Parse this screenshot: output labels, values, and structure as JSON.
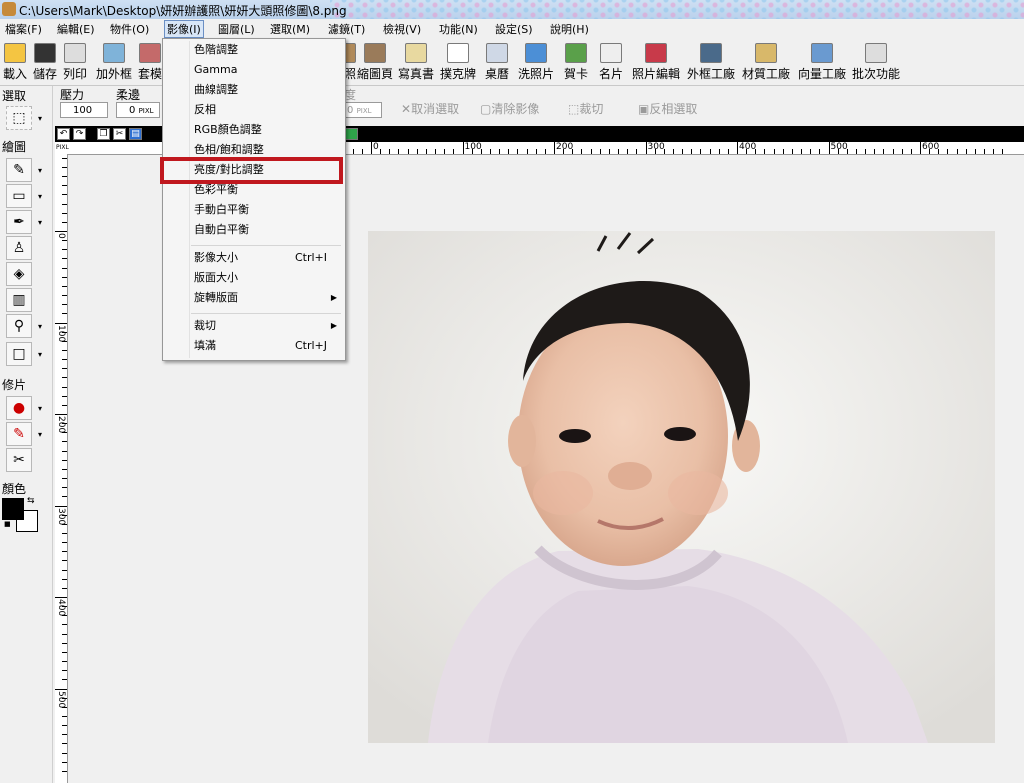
{
  "window": {
    "title": "C:\\Users\\Mark\\Desktop\\妍妍辦護照\\妍妍大頭照修圖\\8.png"
  },
  "menubar": {
    "items": [
      "檔案(F)",
      "編輯(E)",
      "物件(O)",
      "影像(I)",
      "圖層(L)",
      "選取(M)",
      "濾鏡(T)",
      "檢視(V)",
      "功能(N)",
      "設定(S)",
      "說明(H)"
    ],
    "active": "影像(I)"
  },
  "toolbar": {
    "left_items": [
      "載入",
      "儲存",
      "列印",
      "加外框",
      "套模"
    ],
    "right_items": [
      "照",
      "縮圖頁",
      "寫真書",
      "撲克牌",
      "桌曆",
      "洗照片",
      "賀卡",
      "名片",
      "照片編輯",
      "外框工廠",
      "材質工廠",
      "向量工廠",
      "批次功能"
    ]
  },
  "options": {
    "hardness_label": "壓力",
    "hardness_value": "100",
    "feather_label": "柔邊",
    "feather_value": "0",
    "unit": "PIXL",
    "degree_label": "度",
    "degree_value": "0",
    "cancel_selection": "取消選取",
    "clear_image": "清除影像",
    "crop": "裁切",
    "invert_selection": "反相選取"
  },
  "toolbox": {
    "select_label": "選取",
    "draw_label": "繪圖",
    "retouch_label": "修片",
    "color_label": "顏色",
    "fg_color": "#000000",
    "bg_color": "#ffffff"
  },
  "rulers": {
    "unit": "PIXL",
    "h_labels": [
      "0",
      "100",
      "200",
      "300",
      "400",
      "500",
      "600"
    ],
    "v_labels": [
      "0",
      "100",
      "200",
      "300",
      "400",
      "500"
    ]
  },
  "image_menu": {
    "items": [
      {
        "label": "色階調整",
        "shortcut": ""
      },
      {
        "label": "Gamma",
        "shortcut": ""
      },
      {
        "label": "曲線調整",
        "shortcut": ""
      },
      {
        "label": "反相",
        "shortcut": ""
      },
      {
        "label": "RGB顏色調整",
        "shortcut": ""
      },
      {
        "label": "色相/飽和調整",
        "shortcut": ""
      },
      {
        "label": "亮度/對比調整",
        "shortcut": ""
      },
      {
        "label": "色彩平衡",
        "shortcut": ""
      },
      {
        "label": "手動白平衡",
        "shortcut": ""
      },
      {
        "label": "自動白平衡",
        "shortcut": ""
      },
      {
        "label": "影像大小",
        "shortcut": "Ctrl+I"
      },
      {
        "label": "版面大小",
        "shortcut": ""
      },
      {
        "label": "旋轉版面",
        "shortcut": ""
      },
      {
        "label": "裁切",
        "shortcut": ""
      },
      {
        "label": "填滿",
        "shortcut": "Ctrl+J"
      }
    ],
    "highlighted": "亮度/對比調整"
  },
  "colors": {
    "highlight_border": "#c0181e",
    "menu_active": "#d8e6f7"
  }
}
